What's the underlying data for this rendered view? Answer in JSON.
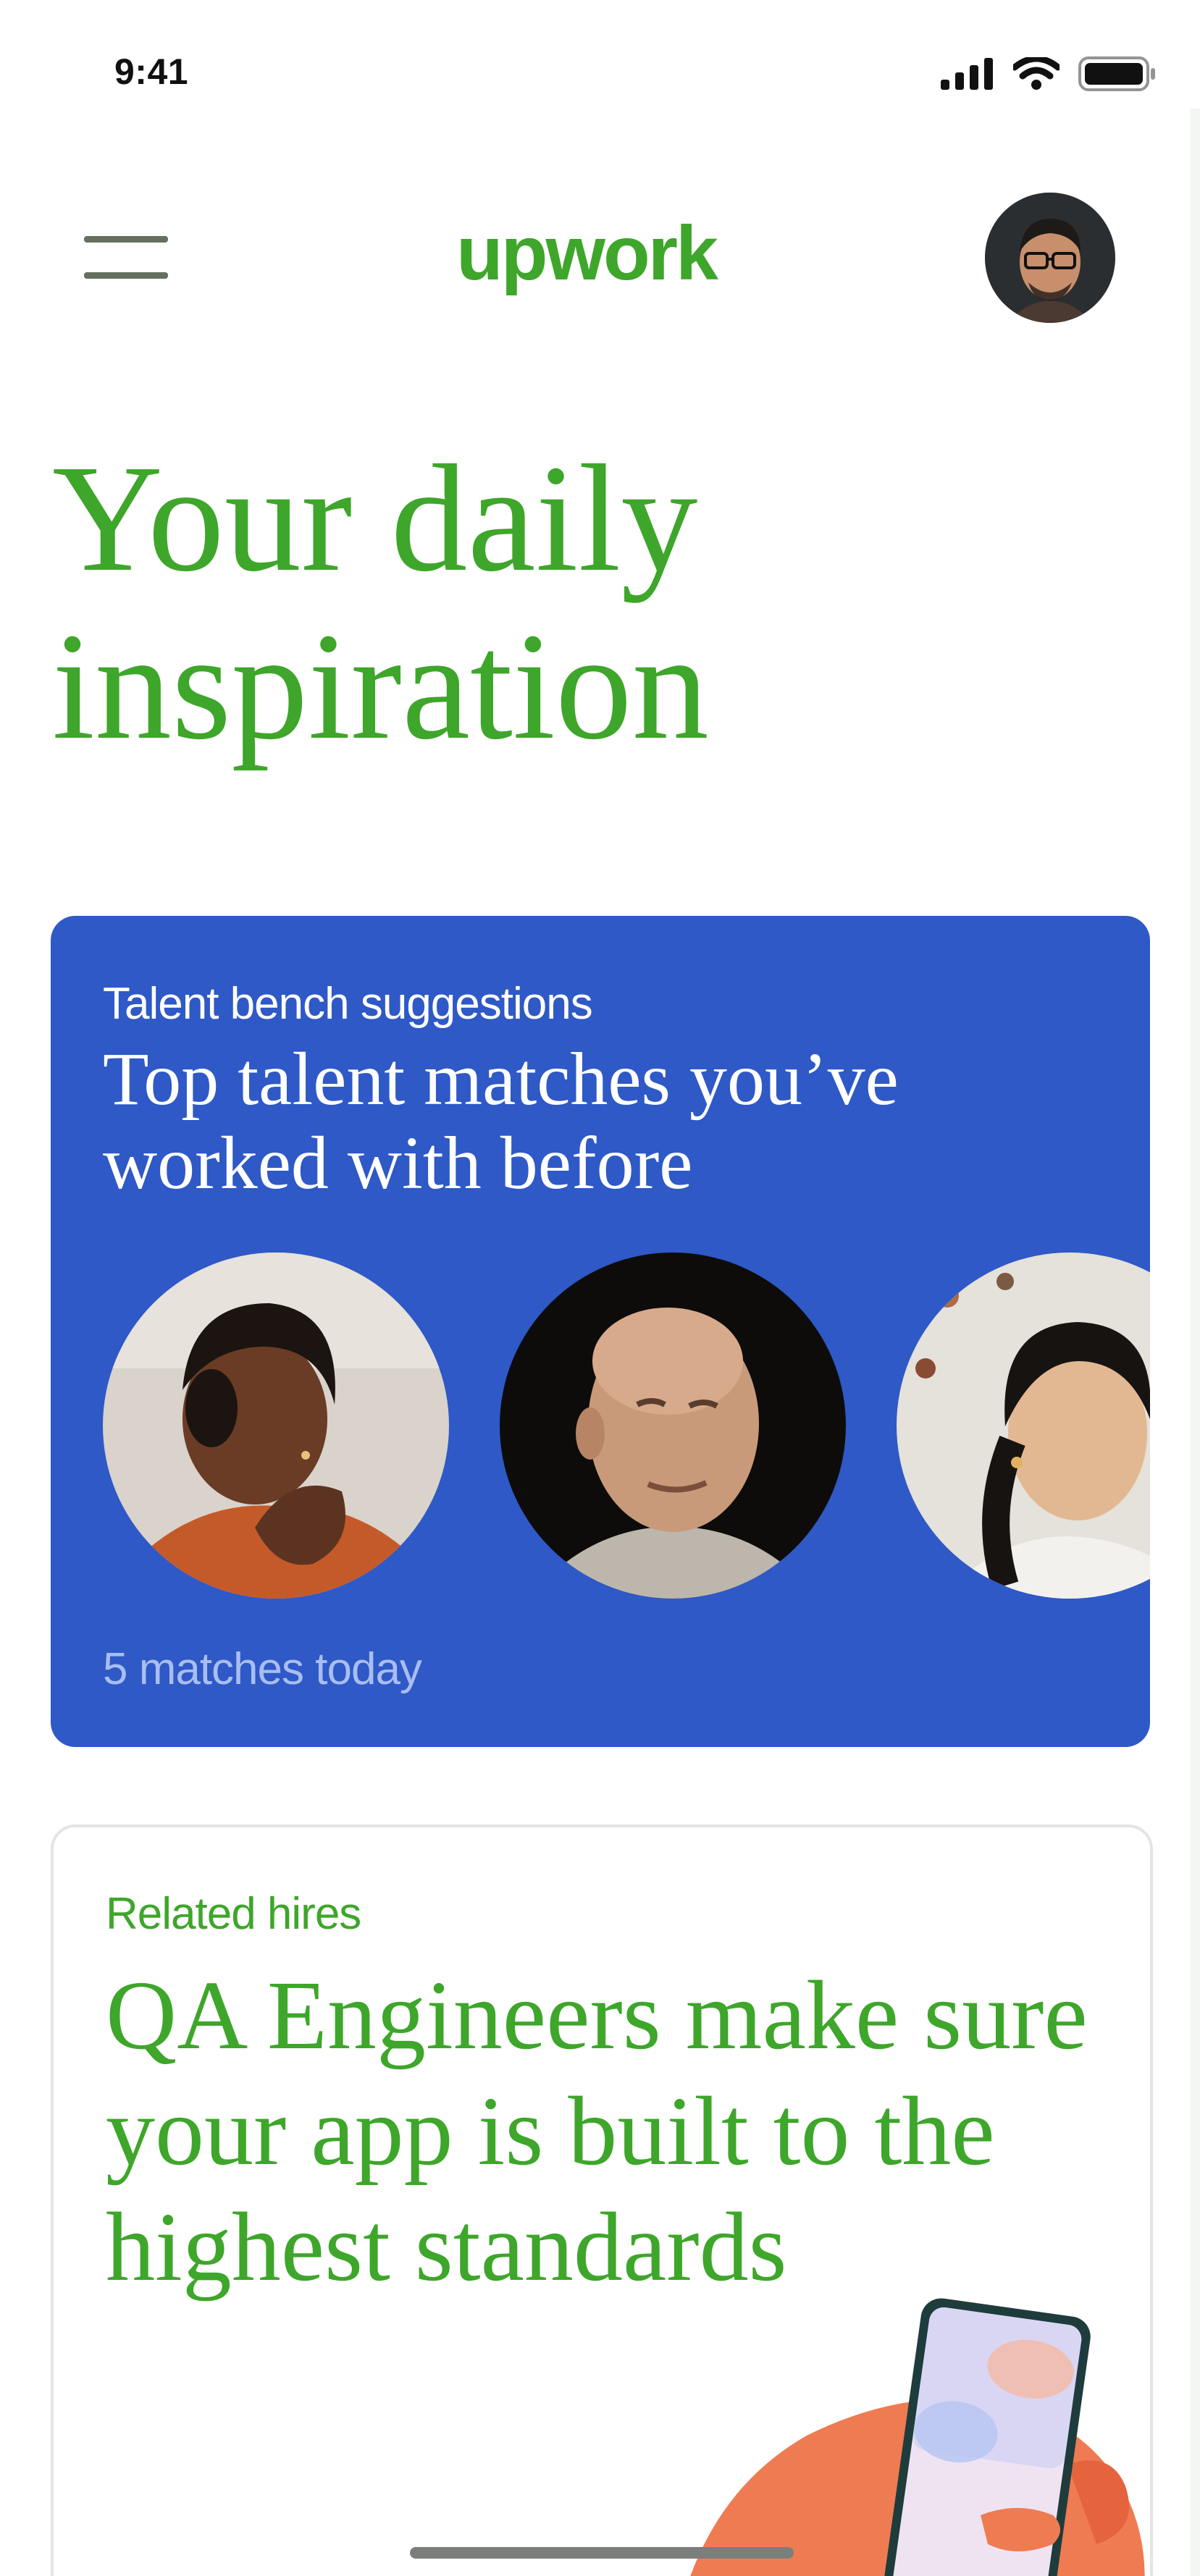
{
  "status_bar": {
    "time": "9:41",
    "icons": [
      "signal-icon",
      "wifi-icon",
      "battery-icon"
    ]
  },
  "nav": {
    "menu_icon": "hamburger-menu-icon",
    "logo": "upwork",
    "avatar": "user-avatar"
  },
  "headline": "Your daily inspiration",
  "talent_card": {
    "eyebrow": "Talent bench suggestions",
    "title": "Top talent matches you’ve worked with before",
    "footer": "5 matches today",
    "portraits": [
      "talent-portrait-1",
      "talent-portrait-2",
      "talent-portrait-3"
    ]
  },
  "related_card": {
    "eyebrow": "Related hires",
    "title": "QA Engineers make sure your app is built to the highest standards",
    "illustration": "hand-holding-phone-illustration"
  },
  "colors": {
    "brand_green": "#3ea62a",
    "card_blue": "#2e59c6",
    "muted_blue_text": "#a9bdf0",
    "menu_gray": "#65705f"
  }
}
